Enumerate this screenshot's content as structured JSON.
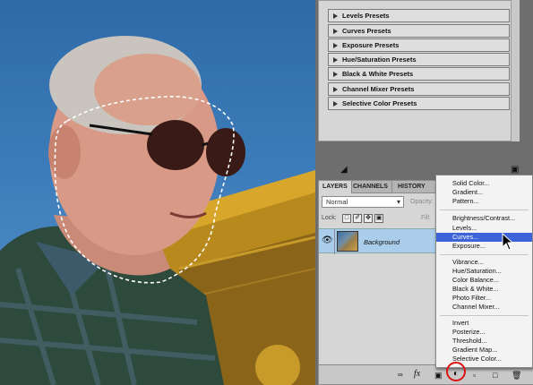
{
  "presets": {
    "items": [
      {
        "label": "Levels Presets"
      },
      {
        "label": "Curves Presets"
      },
      {
        "label": "Exposure Presets"
      },
      {
        "label": "Hue/Saturation Presets"
      },
      {
        "label": "Black & White Presets"
      },
      {
        "label": "Channel Mixer Presets"
      },
      {
        "label": "Selective Color Presets"
      }
    ]
  },
  "layers_panel": {
    "tabs": [
      "LAYERS",
      "CHANNELS",
      "HISTORY"
    ],
    "active_tab": "LAYERS",
    "blend_mode": "Normal",
    "opacity_label": "Opacity:",
    "lock_label": "Lock:",
    "fill_label": "Fill:",
    "layer": {
      "name": "Background",
      "visible": true,
      "selected": true
    },
    "footer_fx": "fx"
  },
  "adjustment_menu": {
    "items": [
      {
        "label": "Solid Color..."
      },
      {
        "label": "Gradient..."
      },
      {
        "label": "Pattern..."
      },
      {
        "label": "Brightness/Contrast..."
      },
      {
        "label": "Levels..."
      },
      {
        "label": "Curves...",
        "highlighted": true
      },
      {
        "label": "Exposure..."
      },
      {
        "label": "Vibrance..."
      },
      {
        "label": "Hue/Saturation..."
      },
      {
        "label": "Color Balance..."
      },
      {
        "label": "Black & White..."
      },
      {
        "label": "Photo Filter..."
      },
      {
        "label": "Channel Mixer..."
      },
      {
        "label": "Invert"
      },
      {
        "label": "Posterize..."
      },
      {
        "label": "Threshold..."
      },
      {
        "label": "Gradient Map..."
      },
      {
        "label": "Selective Color..."
      }
    ]
  },
  "colors": {
    "menu_highlight": "#3d63d8",
    "layer_selected": "#a9cdea",
    "annotation_circle": "#dd1111"
  }
}
